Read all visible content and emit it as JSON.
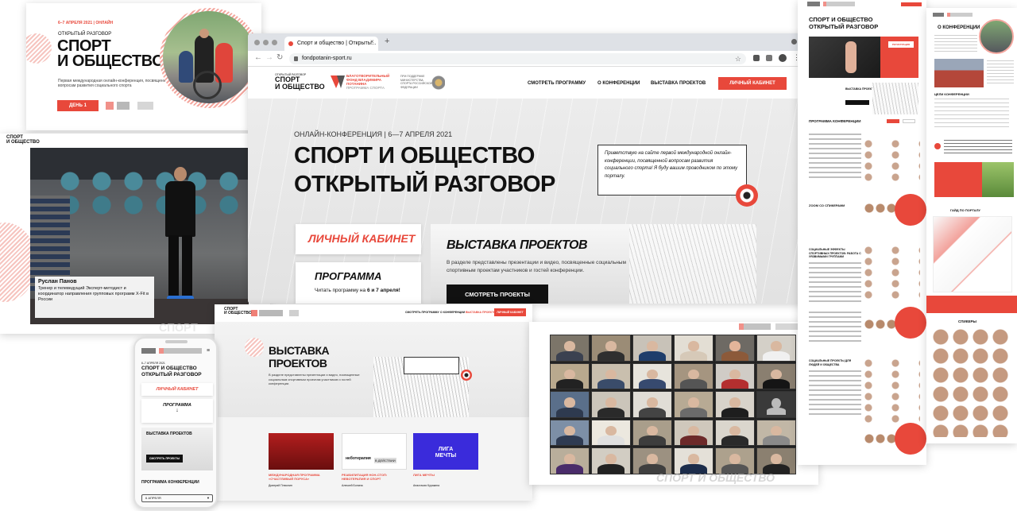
{
  "banner": {
    "date": "6–7 АПРЕЛЯ 2021 | ОНЛАЙН",
    "subtitle": "ОТКРЫТЫЙ РАЗГОВОР",
    "title_line1": "СПОРТ",
    "title_line2": "И ОБЩЕСТВО",
    "desc": "Первая международная онлайн-конференция, посвященная вопросам развития социального спорта",
    "day_button": "ДЕНЬ 1"
  },
  "video": {
    "logo_line1": "СПОРТ",
    "logo_line2": "И ОБЩЕСТВО",
    "name": "Руслан Панов",
    "role": "Тренер и телеведущий Эксперт-методист и координатор направления групповых программ X-Fit в России"
  },
  "browser": {
    "tab_title": "Спорт и общество | Открыты...",
    "url": "fondpotanin-sport.ru",
    "logo_small": "ОТКРЫТЫЙ РАЗГОВОР",
    "logo_line1": "СПОРТ",
    "logo_line2": "И ОБЩЕСТВО",
    "fund_line1": "БЛАГОТВОРИТЕЛЬНЫЙ",
    "fund_line2": "ФОНД ВЛАДИМИРА",
    "fund_line3": "ПОТАНИНА",
    "fund_line4": "ПРОГРАММА СПОРТА",
    "ministry": "ПРИ ПОДДЕРЖКЕ МИНИСТЕРСТВА СПОРТА РОССИЙСКОЙ ФЕДЕРАЦИИ",
    "nav": [
      "СМОТРЕТЬ ПРОГРАММУ",
      "О КОНФЕРЕНЦИИ",
      "ВЫСТАВКА ПРОЕКТОВ"
    ],
    "cabinet_button": "ЛИЧНЫЙ КАБИНЕТ",
    "hero_date": "ОНЛАЙН-КОНФЕРЕНЦИЯ | 6—7 АПРЕЛЯ 2021",
    "hero_title1": "СПОРТ И ОБЩЕСТВО",
    "hero_title2": "ОТКРЫТЫЙ РАЗГОВОР",
    "hero_quote": "Приветствую на сайте первой международной онлайн-конференции, посвященной вопросам развития социального спорта! Я буду вашим проводником по этому порталу.",
    "card_cabinet": "ЛИЧНЫЙ КАБИНЕТ",
    "card_program": "ПРОГРАММА",
    "card_program_text_pre": "Читать программу на",
    "card_program_text_bold": "6 и 7 апреля!",
    "expo_title": "ВЫСТАВКА ПРОЕКТОВ",
    "expo_text": "В разделе представлены презентации и видео, посвященные социальным спортивным проектам участников и гостей конференции.",
    "expo_button": "СМОТРЕТЬ ПРОЕКТЫ"
  },
  "expo_page": {
    "logo_line1": "СПОРТ",
    "logo_line2": "И ОБЩЕСТВО",
    "nav": [
      "СМОТРЕТЬ ПРОГРАММУ",
      "О КОНФЕРЕНЦИИ",
      "ВЫСТАВКА ПРОЕКТОВ"
    ],
    "cabinet_button": "ЛИЧНЫЙ КАБИНЕТ",
    "title1": "ВЫСТАВКА",
    "title2": "ПРОЕКТОВ",
    "text": "В разделе представлены презентации и видео, посвященные социальным спортивным проектам участников и гостей конференции.",
    "projects": [
      {
        "title": "МЕЖДУНАРОДНАЯ ПРОГРАММА «СЧАСТЛИВЫЙ ПОРУСА»",
        "author": "Дмитрий Плюснин"
      },
      {
        "title": "РЕАБИЛИТАЦИЯ НОН-СТОП: НЕВОТЕРАПИЯ И СПОРТ",
        "author": "Алексей Бонина"
      },
      {
        "title": "ЛИГА МЕЧТЫ",
        "author": "Анастасия Куракина"
      }
    ],
    "liga_logo1": "ЛИГА",
    "liga_logo2": "МЕЧТЫ",
    "nevo_label": "неботерапия",
    "nevo_label2": "В ДЕЙСТВИИ"
  },
  "phone": {
    "date": "6–7 АПРЕЛЯ 2021",
    "title1": "СПОРТ И ОБЩЕСТВО",
    "title2": "ОТКРЫТЫЙ РАЗГОВОР",
    "cabinet": "ЛИЧНЫЙ КАБИНЕТ",
    "program": "ПРОГРАММА",
    "expo": "ВЫСТАВКА ПРОЕКТОВ",
    "expo_button": "СМОТРЕТЬ ПРОЕКТЫ",
    "conf_program": "ПРОГРАММА КОНФЕРЕНЦИИ",
    "select": "6 АПРЕЛЯ"
  },
  "videocall": {
    "watermark": "СПОРТ И ОБЩЕСТВО"
  },
  "tall1": {
    "title1": "СПОРТ И ОБЩЕСТВО",
    "title2": "ОТКРЫТЫЙ РАЗГОВОР",
    "reg_button": "РЕГИСТРАЦИЯ",
    "expo": "ВЫСТАВКА ПРОЕКТОВ",
    "program_title": "ПРОГРАММА КОНФЕРЕНЦИИ",
    "zoom": "ZOOM СО СПИКЕРАМИ",
    "section2": "СОЦИАЛЬНЫЕ ЭФФЕКТЫ СПОРТИВНЫХ ПРОЕКТОВ: РАБОТА С УЯЗВИМЫМИ ГРУППАМИ",
    "section3": "СОЦИАЛЬНЫЕ ПРОЕКТЫ ДЛЯ ЛЮДЕЙ И ОБЩЕСТВА"
  },
  "tall2": {
    "about": "О КОНФЕРЕНЦИИ",
    "goals": "ЦЕЛИ КОНФЕРЕНЦИИ",
    "guide": "ГАЙД ПО ПОРТАЛУ",
    "speakers": "СПИКЕРЫ"
  }
}
